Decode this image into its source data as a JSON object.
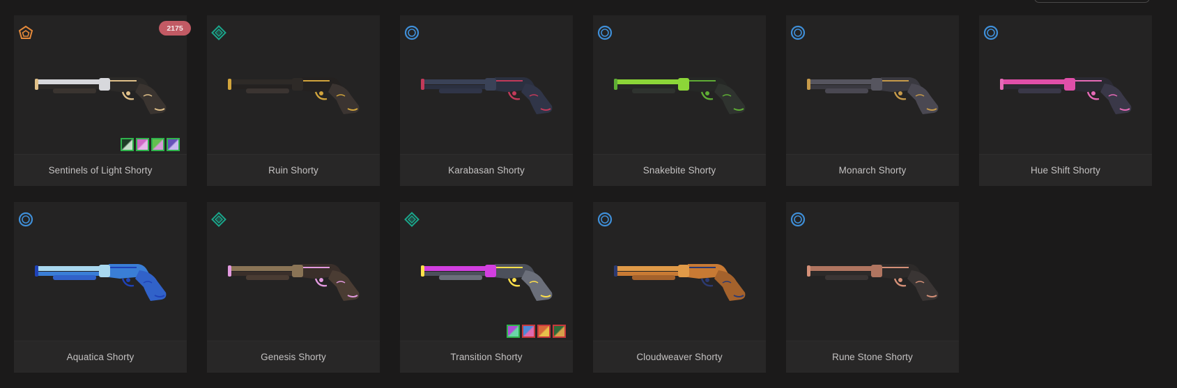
{
  "skins": [
    {
      "name": "Sentinels of Light Shorty",
      "tier": "ultra-edition-pentagon-icon",
      "tier_color": "#e68a3a",
      "price": "2175",
      "colors": {
        "body": "#2c2a28",
        "barrel": "#d7d8dc",
        "accent": "#e0c089",
        "grip": "#3a3430"
      },
      "swatches": [
        {
          "border": "#2fb34c",
          "c1": "#1d3c26",
          "c2": "#c6ddc9"
        },
        {
          "border": "#2fb34c",
          "c1": "#d06ac6",
          "c2": "#e8b6ea"
        },
        {
          "border": "#2fb34c",
          "c1": "#63c04f",
          "c2": "#d59ad5"
        },
        {
          "border": "#2fb34c",
          "c1": "#6651b8",
          "c2": "#c8b8ef"
        }
      ]
    },
    {
      "name": "Ruin Shorty",
      "tier": "premium-diamond-icon",
      "tier_color": "#1aa68b",
      "colors": {
        "body": "#242120",
        "barrel": "#2e2a27",
        "accent": "#d1a43c",
        "grip": "#3b3431"
      }
    },
    {
      "name": "Karabasan Shorty",
      "tier": "select-ring-icon",
      "tier_color": "#3f8fd8",
      "colors": {
        "body": "#2b3040",
        "barrel": "#3a4257",
        "accent": "#c23a5a",
        "grip": "#303548"
      }
    },
    {
      "name": "Snakebite Shorty",
      "tier": "select-ring-icon",
      "tier_color": "#3f8fd8",
      "colors": {
        "body": "#262826",
        "barrel": "#8cd638",
        "accent": "#5fae35",
        "grip": "#2f332f"
      }
    },
    {
      "name": "Monarch Shorty",
      "tier": "select-ring-icon",
      "tier_color": "#3f8fd8",
      "colors": {
        "body": "#3a3940",
        "barrel": "#56555f",
        "accent": "#c69a4a",
        "grip": "#4a4852"
      }
    },
    {
      "name": "Hue Shift Shorty",
      "tier": "select-ring-icon",
      "tier_color": "#3f8fd8",
      "colors": {
        "body": "#2b2a33",
        "barrel": "#e04fa9",
        "accent": "#e66ab7",
        "grip": "#3a3848"
      }
    },
    {
      "name": "Aquatica Shorty",
      "tier": "select-ring-icon",
      "tier_color": "#3f8fd8",
      "colors": {
        "body": "#3a7ed6",
        "barrel": "#a9d8ef",
        "accent": "#1f42b8",
        "grip": "#3162c9"
      }
    },
    {
      "name": "Genesis Shorty",
      "tier": "premium-diamond-icon",
      "tier_color": "#1aa68b",
      "colors": {
        "body": "#3a2f2a",
        "barrel": "#8a7456",
        "accent": "#e39ae0",
        "grip": "#4a3c33"
      }
    },
    {
      "name": "Transition Shorty",
      "tier": "premium-diamond-icon",
      "tier_color": "#1aa68b",
      "colors": {
        "body": "#4c505b",
        "barrel": "#d23fe0",
        "accent": "#ffe04a",
        "grip": "#6b6f7a"
      },
      "swatches": [
        {
          "border": "#2fb34c",
          "c1": "#b04fd8",
          "c2": "#6ad6a8"
        },
        {
          "border": "#c8383c",
          "c1": "#4f8ad8",
          "c2": "#e06ab0"
        },
        {
          "border": "#c8383c",
          "c1": "#d8683a",
          "c2": "#e8c04a"
        },
        {
          "border": "#c8383c",
          "c1": "#2f6a3a",
          "c2": "#d6a04a"
        }
      ]
    },
    {
      "name": "Cloudweaver Shorty",
      "tier": "select-ring-icon",
      "tier_color": "#3f8fd8",
      "colors": {
        "body": "#c87a34",
        "barrel": "#e09a48",
        "accent": "#2c3a72",
        "grip": "#a4622c"
      }
    },
    {
      "name": "Rune Stone Shorty",
      "tier": "select-ring-icon",
      "tier_color": "#3f8fd8",
      "colors": {
        "body": "#2d2a29",
        "barrel": "#b07560",
        "accent": "#d49078",
        "grip": "#3a3534"
      }
    }
  ]
}
